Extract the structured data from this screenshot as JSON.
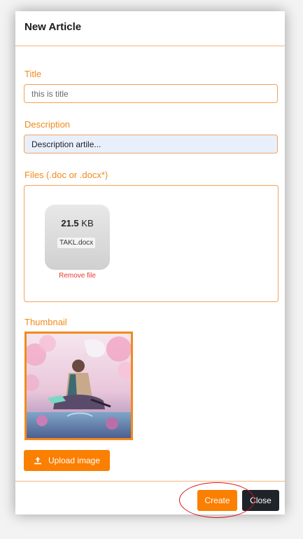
{
  "modal": {
    "title": "New Article"
  },
  "form": {
    "title_label": "Title",
    "title_value": "this is title",
    "description_label": "Description",
    "description_value": "Description artile...",
    "files_label": "Files (.doc or .docx*)",
    "file": {
      "size_number": "21.5",
      "size_unit": "KB",
      "name": "TAKL.docx",
      "remove_label": "Remove file"
    },
    "thumbnail_label": "Thumbnail",
    "upload_label": "Upload image"
  },
  "footer": {
    "create_label": "Create",
    "close_label": "Close"
  },
  "colors": {
    "accent": "#fb7f00",
    "label": "#f08a1c",
    "border": "#f4a259",
    "danger": "#e53935",
    "dark_button": "#1f232a",
    "annotation": "#d8131a"
  },
  "icons": {
    "upload": "upload-icon",
    "thumbnail": "thumbnail-image"
  }
}
